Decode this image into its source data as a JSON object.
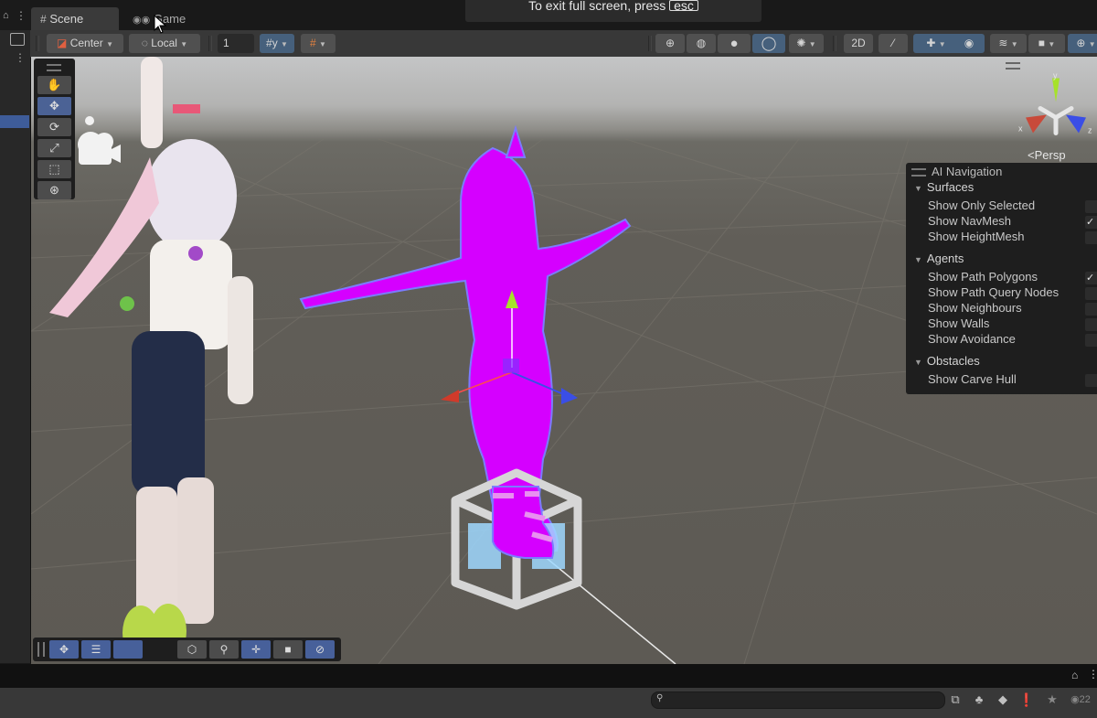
{
  "tabs": [
    {
      "label": "Scene",
      "icon": "grid-icon",
      "active": true
    },
    {
      "label": "Game",
      "icon": "gamepad-icon",
      "active": false
    }
  ],
  "fullscreen_banner": {
    "text": "To exit full screen, press",
    "key": "esc"
  },
  "toolbar": {
    "pivot_mode": "Center",
    "pivot_rotation": "Local",
    "snap_increment": "1",
    "left_buttons": [
      "grid-toggle",
      "grid-snapping"
    ],
    "shading_modes": [
      "wireframe",
      "shaded-wireframe",
      "shaded",
      "unlit"
    ],
    "active_shading": "unlit",
    "right_buttons": [
      "debug-draw-mode",
      "2D",
      "lighting-toggle",
      "effects",
      "scene-visibility",
      "gizmos-layer",
      "camera",
      "gizmos"
    ]
  },
  "tools_palette": {
    "items": [
      "View Tool",
      "Move Tool",
      "Rotate Tool",
      "Scale Tool",
      "Rect Tool",
      "Transform Tool"
    ],
    "active": "Move Tool"
  },
  "orientation_gizmo": {
    "axes": [
      "x",
      "y",
      "z"
    ],
    "projection_label": "<Persp"
  },
  "ai_navigation": {
    "title": "AI Navigation",
    "sections": [
      {
        "name": "Surfaces",
        "options": [
          {
            "label": "Show Only Selected",
            "checked": false
          },
          {
            "label": "Show NavMesh",
            "checked": true
          },
          {
            "label": "Show HeightMesh",
            "checked": false
          }
        ]
      },
      {
        "name": "Agents",
        "options": [
          {
            "label": "Show Path Polygons",
            "checked": true
          },
          {
            "label": "Show Path Query Nodes",
            "checked": false
          },
          {
            "label": "Show Neighbours",
            "checked": false
          },
          {
            "label": "Show Walls",
            "checked": false
          },
          {
            "label": "Show Avoidance",
            "checked": false
          }
        ]
      },
      {
        "name": "Obstacles",
        "options": [
          {
            "label": "Show Carve Hull",
            "checked": false
          }
        ]
      }
    ]
  },
  "bottom_overlay_tools": [
    "move-view",
    "layout",
    "hidden",
    "hidden",
    "nav-surface",
    "search",
    "pan",
    "camera-view",
    "compass"
  ],
  "bottom_panel": {
    "search_placeholder": "",
    "visible_count": "22"
  },
  "check_glyph": "✓",
  "triangle_glyph": "▼",
  "dropdown_glyph": "▼",
  "colors": {
    "accent_blue": "#46607c",
    "selected_magenta": "#d500ff",
    "axis_x": "#d03a2a",
    "axis_y": "#a6e22a",
    "axis_z": "#3a4ee6",
    "nav_cube": "#9fd8ff"
  }
}
